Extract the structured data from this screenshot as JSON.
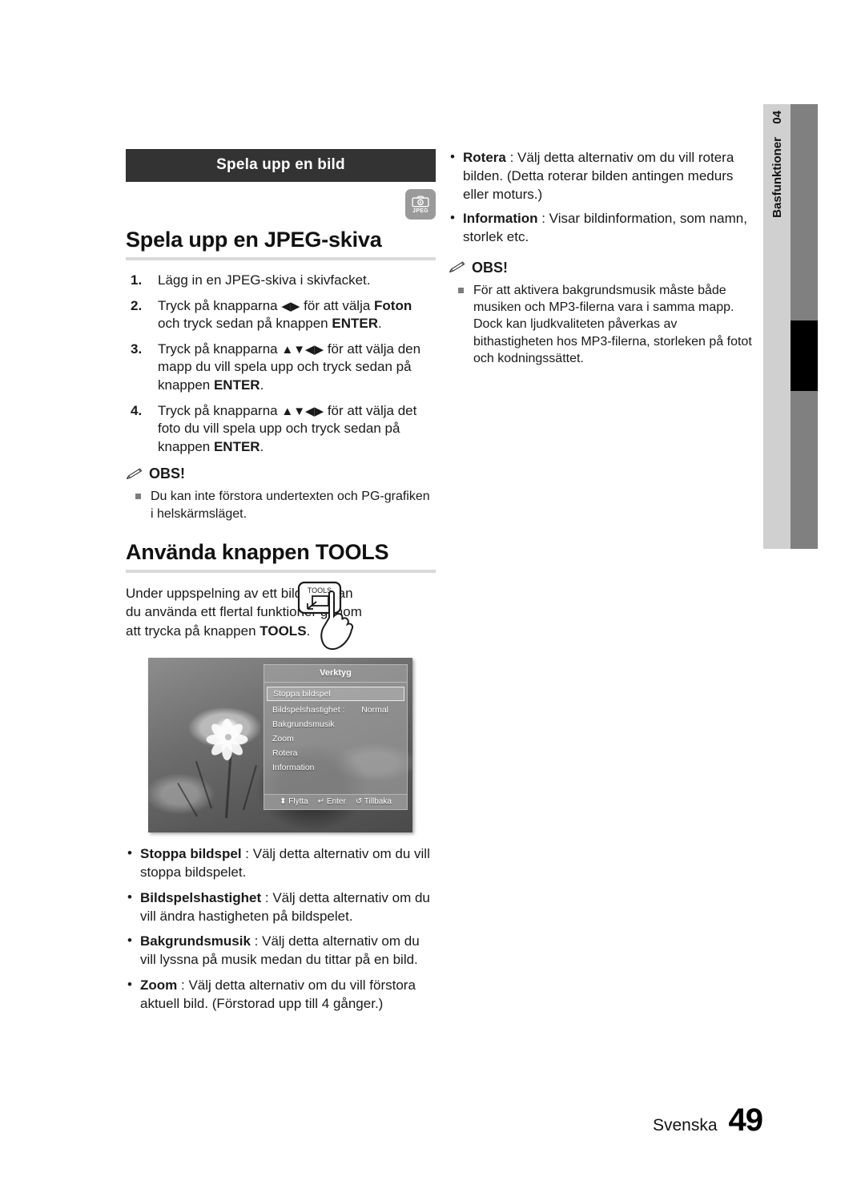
{
  "side_tab": {
    "chapter_number": "04",
    "chapter_label": "Basfunktioner"
  },
  "left_column": {
    "section_bar_title": "Spela upp en bild",
    "media_badge": {
      "icon": "camera-icon",
      "label": "JPEG"
    },
    "heading_jpeg": "Spela upp en JPEG-skiva",
    "steps": [
      {
        "num": "1.",
        "parts": [
          {
            "type": "text",
            "text": "Lägg in en JPEG-skiva i skivfacket."
          }
        ]
      },
      {
        "num": "2.",
        "parts": [
          {
            "type": "text",
            "text": "Tryck på knapparna "
          },
          {
            "type": "arrows",
            "text": "◀▶"
          },
          {
            "type": "text",
            "text": " för att välja "
          },
          {
            "type": "bold",
            "text": "Foton"
          },
          {
            "type": "text",
            "text": " och tryck sedan på knappen "
          },
          {
            "type": "bold",
            "text": "ENTER"
          },
          {
            "type": "text",
            "text": "."
          }
        ]
      },
      {
        "num": "3.",
        "parts": [
          {
            "type": "text",
            "text": "Tryck på knapparna "
          },
          {
            "type": "arrows",
            "text": "▲▼◀▶"
          },
          {
            "type": "text",
            "text": " för att välja den mapp du vill spela upp och tryck sedan på knappen "
          },
          {
            "type": "bold",
            "text": "ENTER"
          },
          {
            "type": "text",
            "text": "."
          }
        ]
      },
      {
        "num": "4.",
        "parts": [
          {
            "type": "text",
            "text": "Tryck på knapparna "
          },
          {
            "type": "arrows",
            "text": "▲▼◀▶"
          },
          {
            "type": "text",
            "text": " för att välja det foto du vill spela upp och tryck sedan på knappen "
          },
          {
            "type": "bold",
            "text": "ENTER"
          },
          {
            "type": "text",
            "text": "."
          }
        ]
      }
    ],
    "note": {
      "icon": "pencil-icon",
      "title": "OBS!",
      "items": [
        "Du kan inte förstora undertexten och PG-grafiken i helskärmsläget."
      ]
    },
    "heading_tools": "Användа knappen TOOLS",
    "tools_intro": {
      "parts": [
        {
          "type": "text",
          "text": "Under uppspelning av ett bildspel kan du använda ett flertal funktioner genom att trycka på knappen "
        },
        {
          "type": "bold",
          "text": "TOOLS"
        },
        {
          "type": "text",
          "text": "."
        }
      ],
      "button_illustration": {
        "icon": "tools-button-hand-icon",
        "button_label": "TOOLS"
      }
    },
    "tv_screenshot": {
      "menu_title": "Verktyg",
      "menu_items": [
        {
          "label": "Stoppa bildspel",
          "value": "",
          "selected": true
        },
        {
          "label": "Bildspelshastighet :",
          "value": "Normal",
          "selected": false
        },
        {
          "label": "Bakgrundsmusik",
          "value": "",
          "selected": false
        },
        {
          "label": "Zoom",
          "value": "",
          "selected": false
        },
        {
          "label": "Rotera",
          "value": "",
          "selected": false
        },
        {
          "label": "Information",
          "value": "",
          "selected": false
        }
      ],
      "footer_hints": [
        {
          "icon": "updown-arrow-icon",
          "glyph": "⬍",
          "label": "Flytta"
        },
        {
          "icon": "enter-icon",
          "glyph": "↵",
          "label": "Enter"
        },
        {
          "icon": "return-icon",
          "glyph": "↺",
          "label": "Tillbaka"
        }
      ]
    },
    "option_bullets": [
      {
        "term": "Stoppa bildspel",
        "separator": " : ",
        "description": "Välj detta alternativ om du vill stoppa bildspelet."
      },
      {
        "term": "Bildspelshastighet",
        "separator": " : ",
        "description": "Välj detta alternativ om du vill ändra hastigheten på bildspelet."
      },
      {
        "term": "Bakgrundsmusik",
        "separator": " : ",
        "description": "Välj detta alternativ om du vill lyssna på musik medan du tittar på en bild."
      },
      {
        "term": "Zoom",
        "separator": " : ",
        "description": "Välj detta alternativ om du vill förstora aktuell bild. (Förstorad upp till 4 gånger.)"
      }
    ]
  },
  "right_column": {
    "option_bullets": [
      {
        "term": "Rotera",
        "separator": " : ",
        "description": "Välj detta alternativ om du vill rotera bilden. (Detta roterar bilden antingen medurs eller moturs.)"
      },
      {
        "term": "Information",
        "separator": " : ",
        "description": "Visar bildinformation, som namn, storlek etc."
      }
    ],
    "note": {
      "icon": "pencil-icon",
      "title": "OBS!",
      "items": [
        "För att aktivera bakgrundsmusik måste både musiken och MP3-filerna vara i samma mapp. Dock kan ljudkvaliteten påverkas av bithastigheten hos MP3-filerna, storleken på fotot och kodningssättet."
      ]
    }
  },
  "footer": {
    "language": "Svenska",
    "page_number": "49"
  },
  "colors": {
    "section_bar_bg": "#333333",
    "rule": "#d9d9d9",
    "badge_bg": "#9a9a9a",
    "tab_light": "#d0d0d0",
    "tab_dark": "#808080",
    "tab_marker": "#000000"
  }
}
